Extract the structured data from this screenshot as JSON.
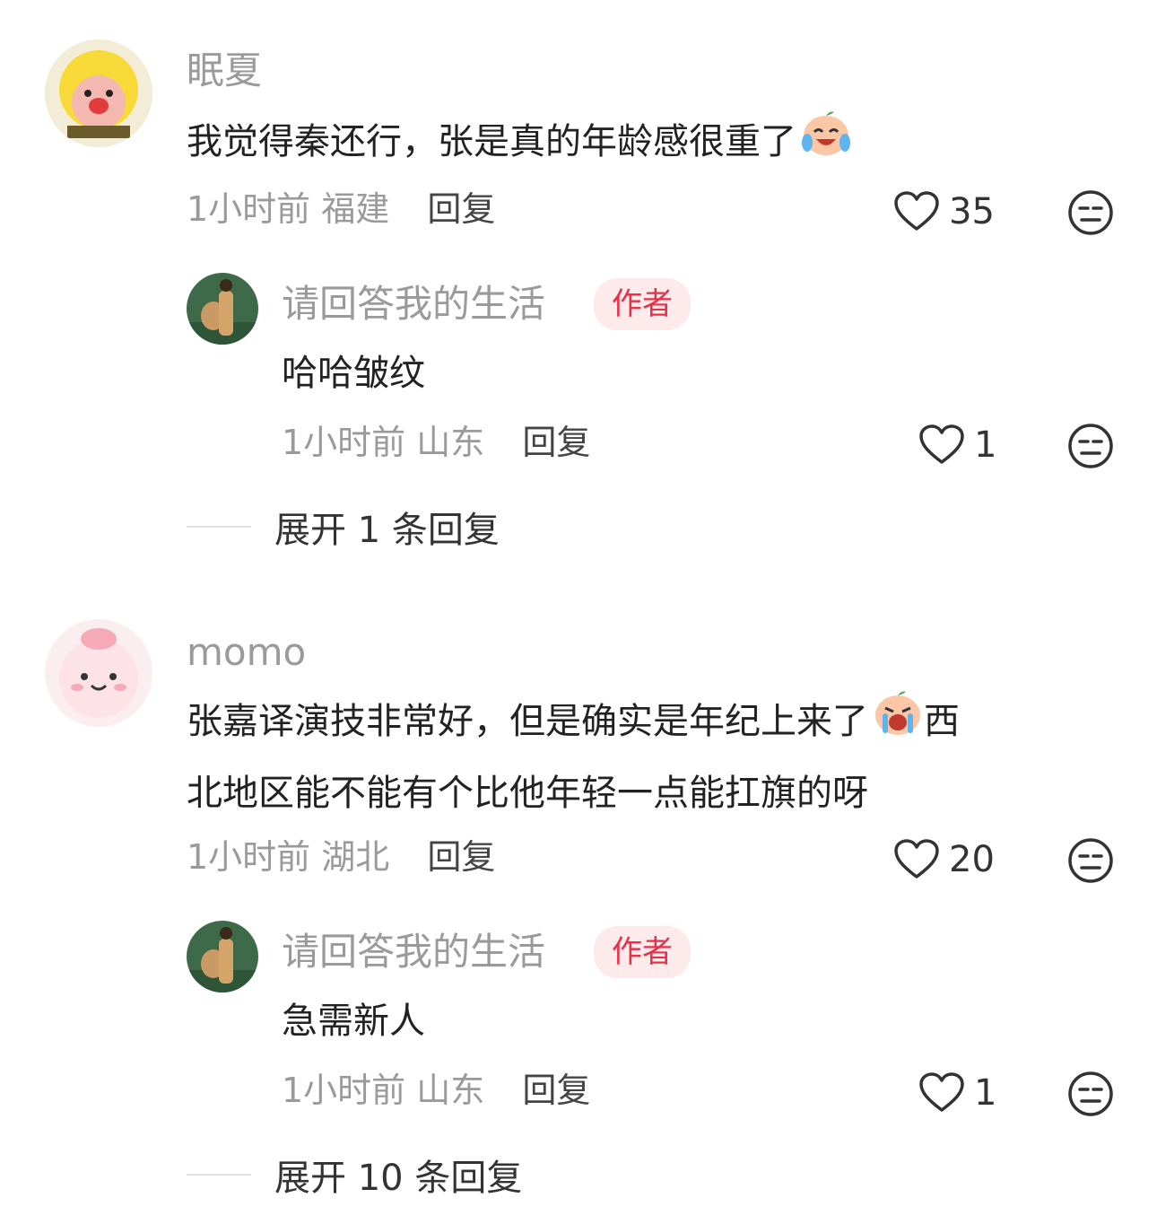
{
  "comments": [
    {
      "username": "眠夏",
      "text_before_emoji": "我觉得秦还行，张是真的年龄感很重了",
      "time": "1小时前",
      "location": "福建",
      "reply_label": "回复",
      "likes": "35",
      "replies": [
        {
          "username": "请回答我的生活",
          "author_tag": "作者",
          "text": "哈哈皱纹",
          "time": "1小时前",
          "location": "山东",
          "reply_label": "回复",
          "likes": "1"
        }
      ],
      "expand_label": "展开 1 条回复"
    },
    {
      "username": "momo",
      "text_line1_before_emoji": "张嘉译演技非常好，但是确实是年纪上来了",
      "text_line1_after_emoji": "西",
      "text_line2": "北地区能不能有个比他年轻一点能扛旗的呀",
      "time": "1小时前",
      "location": "湖北",
      "reply_label": "回复",
      "likes": "20",
      "replies": [
        {
          "username": "请回答我的生活",
          "author_tag": "作者",
          "text": "急需新人",
          "time": "1小时前",
          "location": "山东",
          "reply_label": "回复",
          "likes": "1"
        }
      ],
      "expand_label": "展开 10 条回复"
    }
  ],
  "colors": {
    "author_tag_bg": "#fdebec",
    "author_tag_text": "#e8304a",
    "username": "#9a9a9a"
  }
}
